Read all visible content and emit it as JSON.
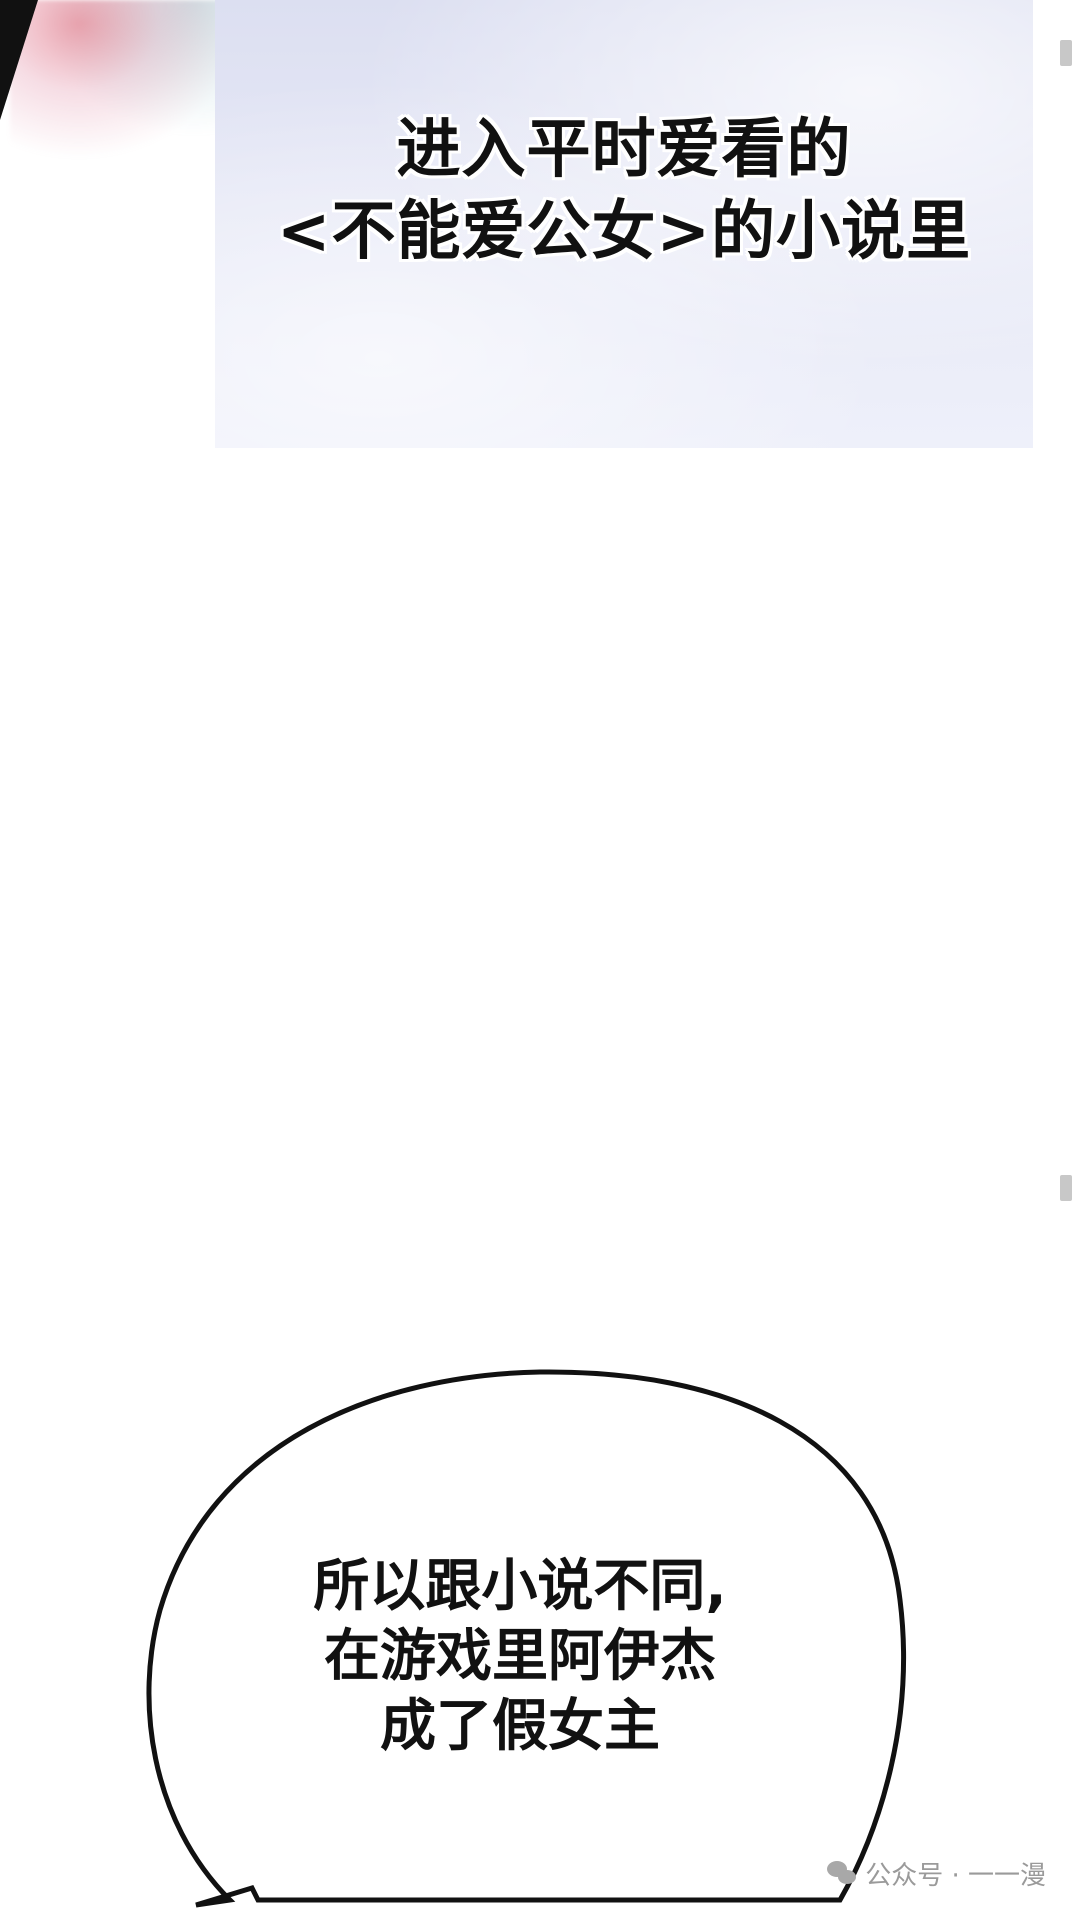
{
  "caption": {
    "line1": "进入平时爱看的",
    "line2": "<不能爱公女>的小说里"
  },
  "speech_bubble": {
    "line1": "所以跟小说不同,",
    "line2": "在游戏里阿伊杰",
    "line3": "成了假女主"
  },
  "watermark": {
    "icon": "wechat-icon",
    "text": "公众号 · 一一漫"
  },
  "colors": {
    "caption_panel": "#e4e6f5",
    "text": "#111111",
    "watermark": "#9a9a9a"
  }
}
